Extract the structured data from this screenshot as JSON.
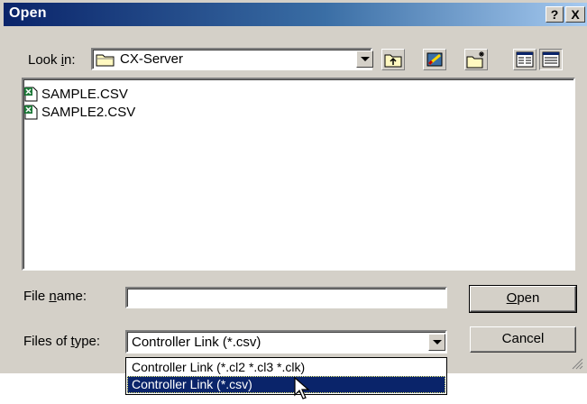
{
  "window": {
    "title": "Open",
    "help_label": "?",
    "close_label": "X"
  },
  "look_in": {
    "label_pre": "Look ",
    "label_key": "i",
    "label_post": "n:",
    "value": "CX-Server",
    "icons": [
      "folder-icon",
      "up-one-level-icon",
      "desktop-icon",
      "new-folder-icon",
      "list-view-icon",
      "details-view-icon"
    ]
  },
  "files": [
    {
      "name": "SAMPLE.CSV",
      "icon": "csv-file-icon"
    },
    {
      "name": "SAMPLE2.CSV",
      "icon": "csv-file-icon"
    }
  ],
  "file_name": {
    "label_pre": "File ",
    "label_key": "n",
    "label_post": "ame:",
    "value": ""
  },
  "file_type": {
    "label_pre": "Files of ",
    "label_key": "t",
    "label_post": "ype:",
    "value": "Controller Link (*.csv)",
    "options": [
      "Controller Link (*.cl2 *.cl3 *.clk)",
      "Controller Link (*.csv)"
    ],
    "selected_index": 1
  },
  "buttons": {
    "open_key": "O",
    "open_rest": "pen",
    "cancel": "Cancel"
  },
  "colors": {
    "title_active": "#0a246a",
    "face": "#d4d0c8",
    "selection": "#0a246a"
  }
}
